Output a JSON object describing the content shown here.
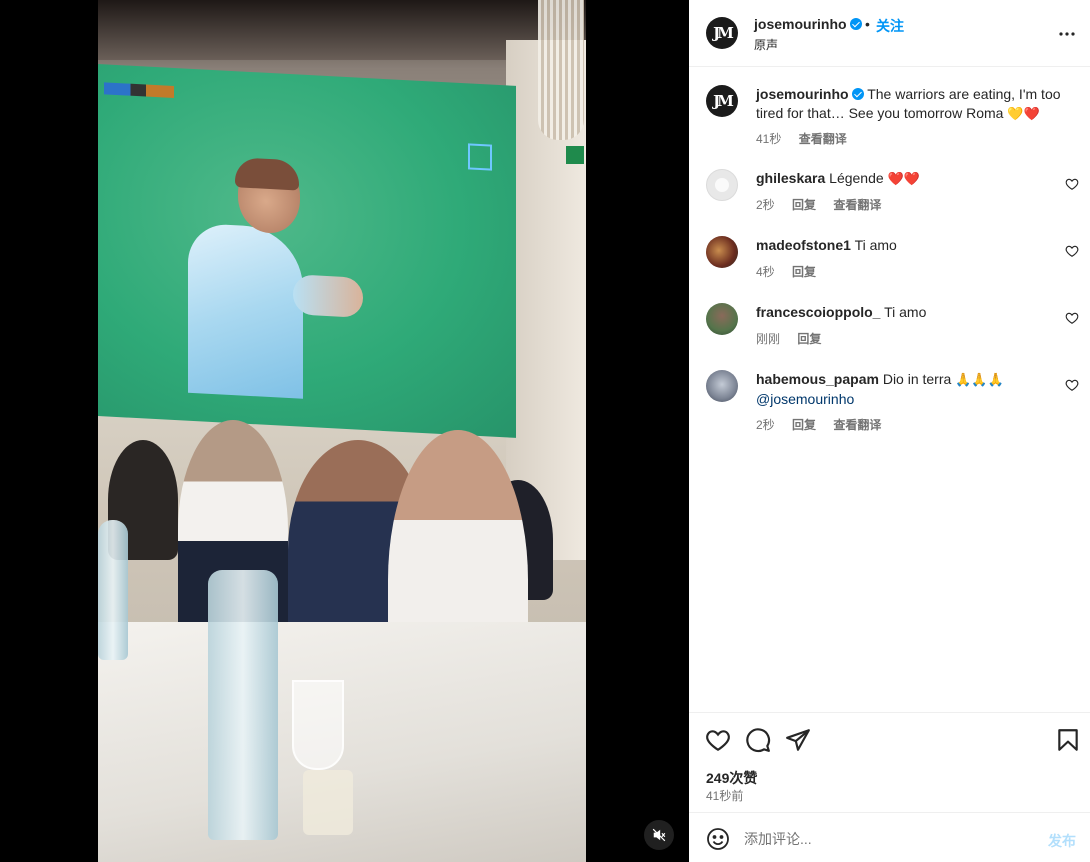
{
  "post": {
    "username": "josemourinho",
    "avatar_text": "JM",
    "follow_label": "关注",
    "dot": "•",
    "audio_label": "原声"
  },
  "caption": {
    "username": "josemourinho",
    "text": "The warriors are eating, I'm too tired for that… See you tomorrow Roma",
    "emojis": "💛❤️",
    "time": "41秒",
    "translate": "查看翻译"
  },
  "comments": [
    {
      "username": "ghileskara",
      "text": "Légende",
      "emojis": "❤️❤️",
      "time": "2秒",
      "reply": "回复",
      "translate": "查看翻译"
    },
    {
      "username": "madeofstone1",
      "text": "Ti amo",
      "emojis": "",
      "time": "4秒",
      "reply": "回复",
      "translate": ""
    },
    {
      "username": "francescoioppolo_",
      "text": "Ti amo",
      "emojis": "",
      "time": "刚刚",
      "reply": "回复",
      "translate": ""
    },
    {
      "username": "habemous_papam",
      "text": "Dio in terra",
      "emojis": "🙏🙏🙏",
      "mention": "@josemourinho",
      "time": "2秒",
      "reply": "回复",
      "translate": "查看翻译"
    }
  ],
  "stats": {
    "likes": "249次赞",
    "time_ago": "41秒前"
  },
  "composer": {
    "placeholder": "添加评论...",
    "post_label": "发布"
  },
  "colors": {
    "accent": "#0095f6",
    "muted": "#737373",
    "post_disabled": "#b2dffc"
  },
  "icons": {
    "more": "more-icon",
    "heart": "heart-icon",
    "comment": "comment-icon",
    "share": "share-icon",
    "save": "bookmark-icon",
    "emoji": "emoji-icon",
    "mute": "muted-speaker-icon"
  }
}
